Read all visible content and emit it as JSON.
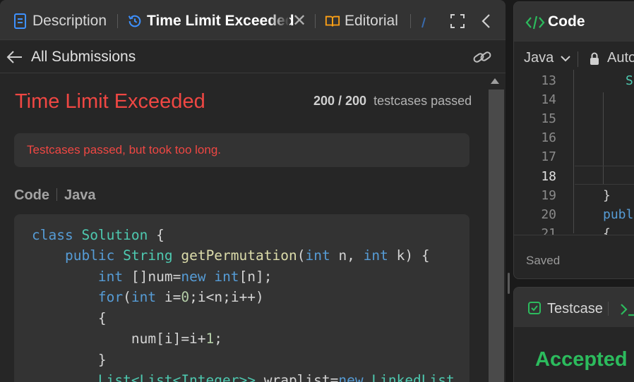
{
  "tabs": {
    "description": "Description",
    "submission": "Time Limit Exceeded",
    "editorial": "Editorial"
  },
  "subheader": {
    "back_label": "All Submissions"
  },
  "result": {
    "status": "Time Limit Exceeded",
    "passed": "200 / 200",
    "passed_suffix": "testcases passed",
    "message": "Testcases passed, but took too long."
  },
  "code_header": {
    "label": "Code",
    "language": "Java"
  },
  "code_lines": [
    "class Solution {",
    "    public String getPermutation(int n, int k) {",
    "        int []num=new int[n];",
    "        for(int i=0;i<n;i++)",
    "        {",
    "            num[i]=i+1;",
    "        }",
    "        List<List<Integer>> wraplist=new LinkedList"
  ],
  "editor": {
    "title": "Code",
    "language": "Java",
    "autosave": "Auto",
    "line_numbers": [
      "13",
      "14",
      "15",
      "16",
      "17",
      "18",
      "19",
      "20",
      "21"
    ],
    "current_line": "18",
    "snippet_13": "S",
    "snippet_19": "}",
    "snippet_20": "publ",
    "snippet_21": "{",
    "saved": "Saved"
  },
  "testcase": {
    "title": "Testcase",
    "result": "Accepted"
  },
  "colors": {
    "error": "#ef4743",
    "success": "#2cbb5d",
    "accent_blue": "#3e91ff",
    "accent_orange": "#ffa116"
  }
}
